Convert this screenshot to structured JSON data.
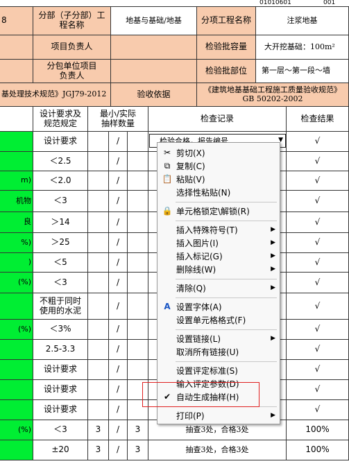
{
  "top_code": {
    "left": "01010601",
    "right": "001"
  },
  "header": {
    "r1_left": "8",
    "sub_unit_label": "分部（子分部）工程名称",
    "sub_unit_value": "地基与基础/地基",
    "item_label": "分项工程名称",
    "item_value": "注浆地基",
    "manager_label": "项目负责人",
    "capacity_label": "检验批容量",
    "capacity_value": "大开挖基础：100m²",
    "sub_manager_label": "分包单位项目负责人",
    "position_label": "检验批部位",
    "position_value": "第一层～第一段～墙",
    "standard_left": "基处理技术规范》JGJ79-2012",
    "basis_label": "验收依据",
    "basis_value": "《建筑地基基础工程施工质量验收规范》GB 50202-2002"
  },
  "columns": {
    "design": "设计要求及规范规定",
    "sample": "最小/实际抽样数量",
    "record": "检查记录",
    "result": "检查结果"
  },
  "rows": [
    {
      "left": "",
      "design": "设计要求",
      "slash": "/",
      "result": "√"
    },
    {
      "left": "",
      "design": "＜2.5",
      "slash": "/",
      "result": "√"
    },
    {
      "left": "m)",
      "design": "＜2.0",
      "slash": "/",
      "result": "√"
    },
    {
      "left": "机物",
      "design": "＜3",
      "slash": "/",
      "result": "√"
    },
    {
      "left": "良",
      "design": "＞14",
      "slash": "/",
      "result": "√"
    },
    {
      "left": "%)",
      "design": "＞25",
      "slash": "/",
      "result": "√"
    },
    {
      "left": ")",
      "design": "＜5",
      "slash": "/",
      "result": "√"
    },
    {
      "left": "(%)",
      "design": "＜3",
      "slash": "/",
      "result": "√"
    },
    {
      "left": "",
      "design": "不粗于同时使用的水泥",
      "slash": "/",
      "result": "√"
    },
    {
      "left": "(%)",
      "design": "＜3%",
      "slash": "/",
      "result": "√"
    },
    {
      "left": "",
      "design": "2.5-3.3",
      "slash": "/",
      "result": "√"
    },
    {
      "left": "",
      "design": "设计要求",
      "slash": "/",
      "result": "√"
    },
    {
      "left": "",
      "design": "设计要求",
      "slash": "/",
      "result": "√"
    },
    {
      "left": "",
      "design": "设计要求",
      "slash": "/",
      "result": "√"
    },
    {
      "left": "(%)",
      "design": "＜3",
      "min": "3",
      "slash": "/",
      "actual": "3",
      "record": "抽查3处，合格3处",
      "result": "100%"
    },
    {
      "left": "",
      "design": "±20",
      "min": "3",
      "slash": "/",
      "actual": "3",
      "record": "抽查3处，合格3处",
      "result": "100%"
    }
  ],
  "dropdown": {
    "value": "检验合格，报告编号"
  },
  "menu": {
    "cut": "剪切(X)",
    "copy": "复制(C)",
    "paste": "粘贴(V)",
    "paste_special": "选择性粘贴(N)",
    "lock": "单元格锁定\\解锁(R)",
    "insert_symbol": "插入特殊符号(T)",
    "insert_picture": "插入图片(I)",
    "insert_mark": "插入标记(G)",
    "strikethrough": "删除线(W)",
    "clear": "清除(Q)",
    "set_font": "设置字体(A)",
    "set_format": "设置单元格格式(F)",
    "set_link": "设置链接(L)",
    "cancel_links": "取消所有链接(U)",
    "set_eval": "设置评定标准(S)",
    "input_eval": "输入评定参数(D)",
    "auto_sample": "自动生成抽样(H)",
    "print": "打印(P)"
  },
  "icons": {
    "cut": "scissors-icon",
    "copy": "copy-icon",
    "paste": "clipboard-icon",
    "lock": "lock-icon",
    "font": "font-icon",
    "check": "check-icon",
    "submenu": "triangle-right-icon"
  },
  "colors": {
    "peach": "#f8cbad",
    "green": "#00ee33",
    "highlight": "#e02020"
  }
}
